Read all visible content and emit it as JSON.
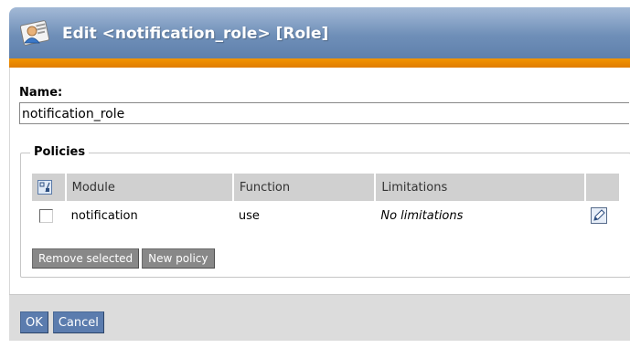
{
  "header": {
    "title": "Edit <notification_role> [Role]",
    "icon": "role-icon"
  },
  "name_field": {
    "label": "Name:",
    "value": "notification_role"
  },
  "policies": {
    "legend": "Policies",
    "columns": [
      "Module",
      "Function",
      "Limitations"
    ],
    "rows": [
      {
        "module": "notification",
        "function": "use",
        "limitations": "No limitations"
      }
    ],
    "buttons": {
      "remove_selected": "Remove selected",
      "new_policy": "New policy"
    }
  },
  "footer": {
    "ok": "OK",
    "cancel": "Cancel"
  },
  "colors": {
    "title_bar": "#6f8fb8",
    "accent_orange": "#f29400",
    "button_gray": "#888888",
    "button_blue": "#5b7cae"
  }
}
